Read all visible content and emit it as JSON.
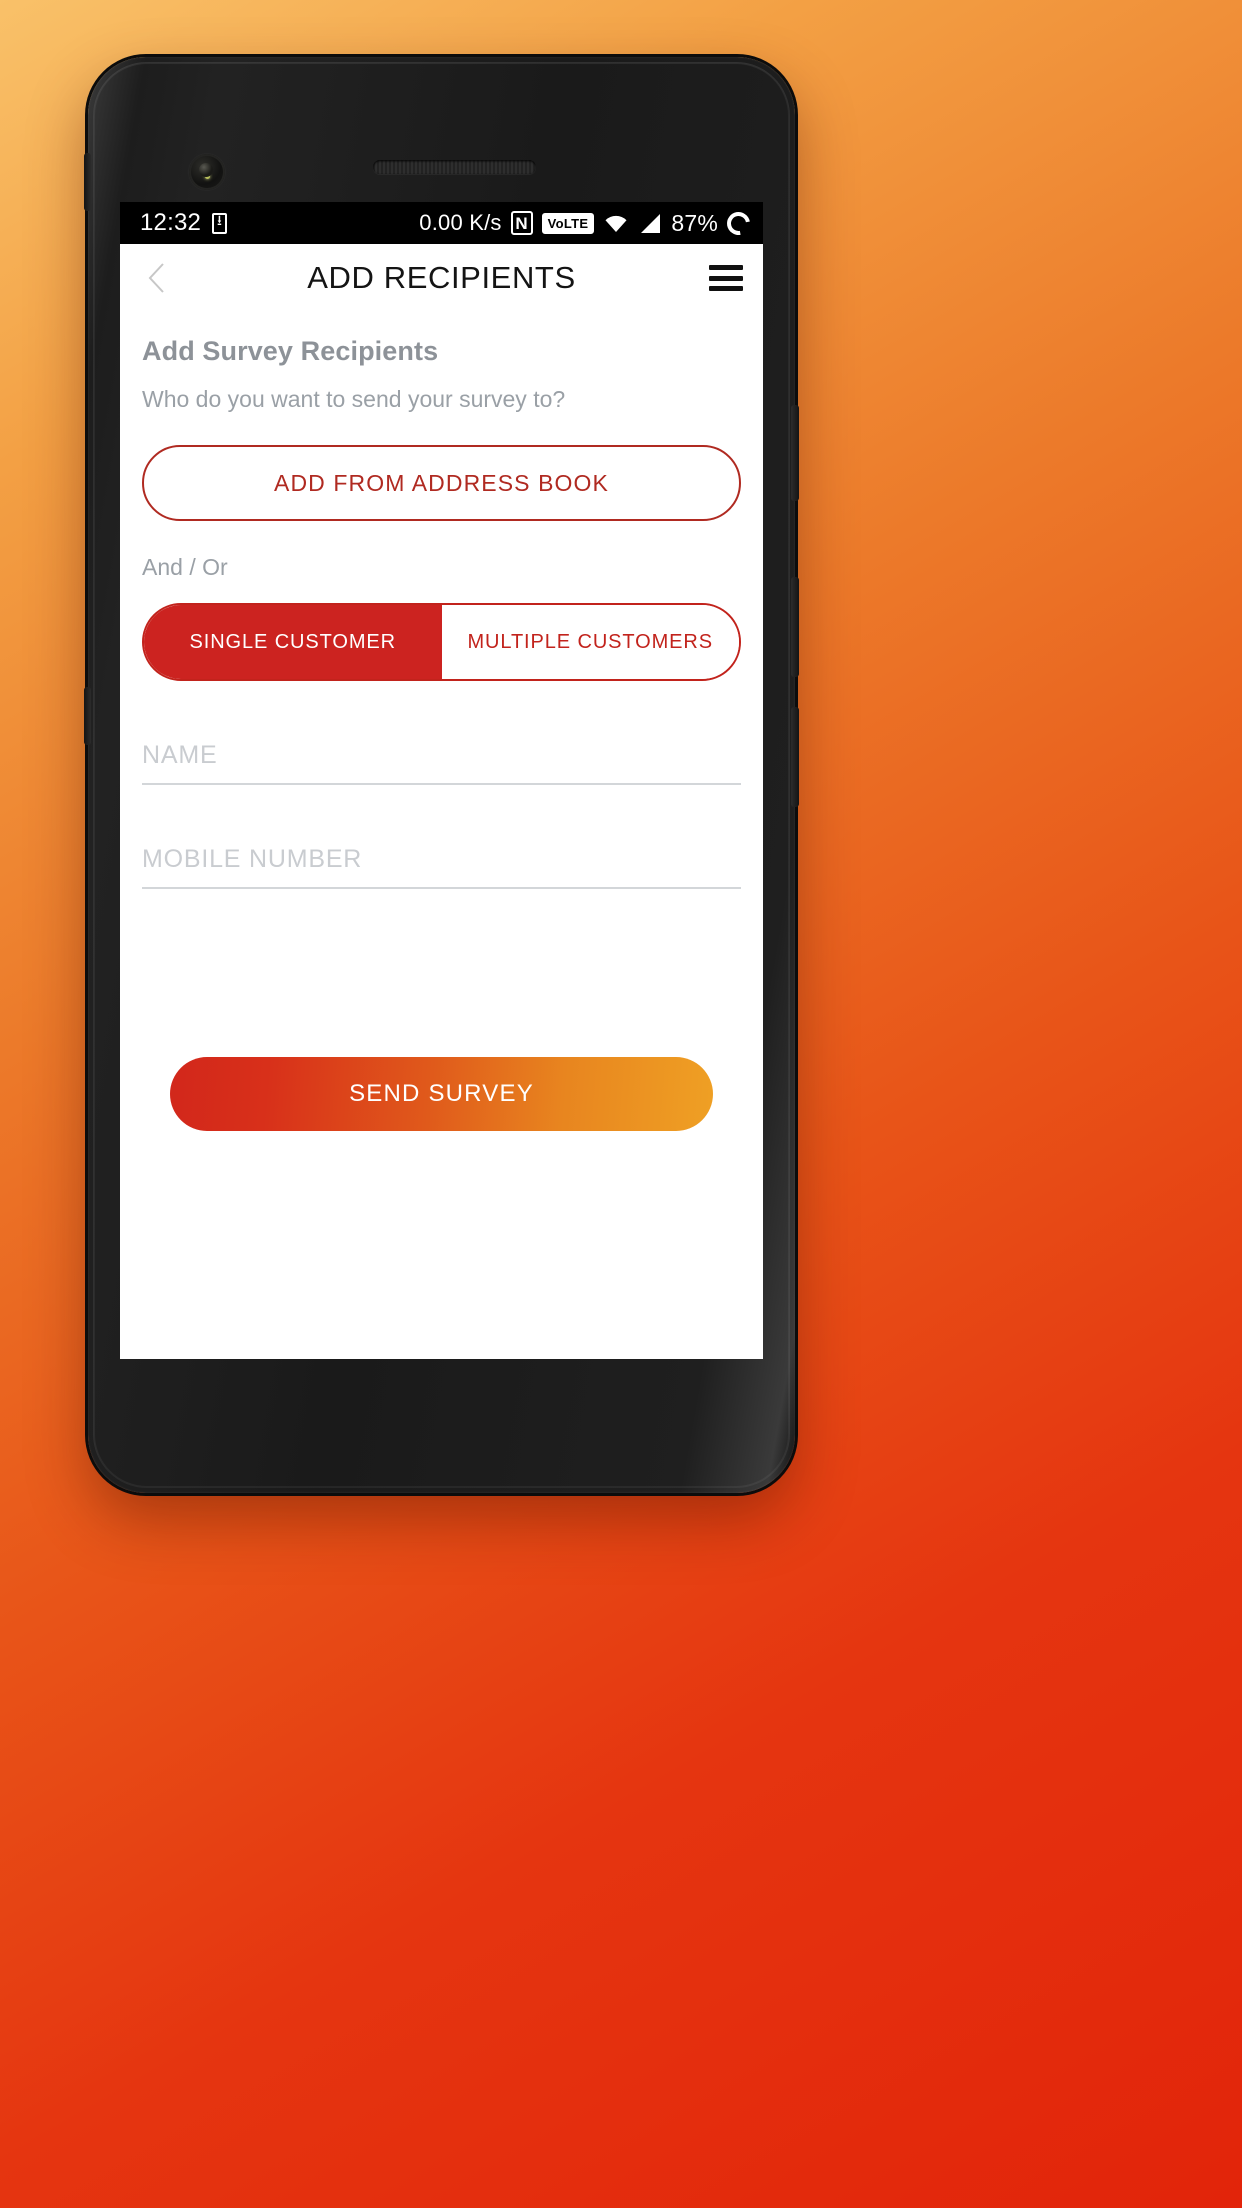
{
  "statusbar": {
    "time": "12:32",
    "download_icon": "download-indicator-icon",
    "network_speed": "0.00 K/s",
    "nfc_icon": "nfc-icon",
    "nfc_label": "N",
    "volte_label": "VoLTE",
    "wifi_icon": "wifi-icon",
    "signal_icon": "cellular-signal-icon",
    "battery_percent": "87%",
    "battery_icon": "battery-charging-ring-icon"
  },
  "appbar": {
    "back_icon": "back-chevron-icon",
    "title": "ADD RECIPIENTS",
    "menu_icon": "hamburger-menu-icon"
  },
  "content": {
    "section_title": "Add Survey Recipients",
    "section_subtitle": "Who do you want to send your survey to?",
    "address_book_button": "ADD FROM ADDRESS BOOK",
    "and_or_label": "And / Or",
    "segments": [
      {
        "label": "SINGLE CUSTOMER",
        "active": true
      },
      {
        "label": "MULTIPLE CUSTOMERS",
        "active": false
      }
    ],
    "fields": [
      {
        "placeholder": "NAME",
        "value": ""
      },
      {
        "placeholder": "MOBILE NUMBER",
        "value": ""
      }
    ],
    "send_button": "SEND SURVEY"
  },
  "colors": {
    "brand_red": "#CC2320",
    "outline_red": "#B02A21",
    "gradient_start": "#D2271B",
    "gradient_end": "#EFA024",
    "muted_text": "#9aa0a6",
    "placeholder": "#c9ccd0",
    "background_start": "#F9C169",
    "background_end": "#E2240A"
  }
}
